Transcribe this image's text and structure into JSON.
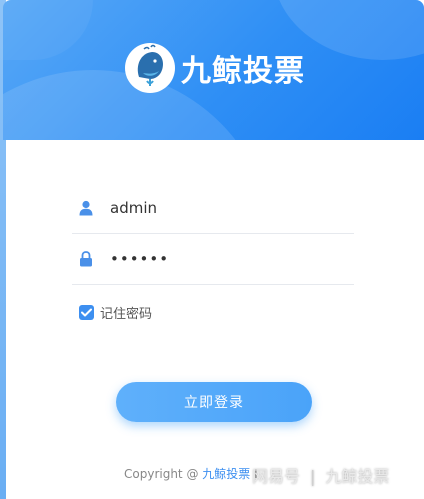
{
  "header": {
    "brand_name": "九鲸投票",
    "logo_icon": "whale-logo-icon",
    "accent_color": "#1a7ef3"
  },
  "form": {
    "username_icon": "user-icon",
    "username_value": "admin",
    "password_icon": "lock-icon",
    "password_value": "••••••",
    "remember_checked": true,
    "remember_label": "记住密码"
  },
  "login_button": {
    "label": "立即登录"
  },
  "footer": {
    "copyright_prefix": "Copyright @",
    "copyright_link": "九鲸投票",
    "copyright_suffix": "I"
  },
  "watermark": {
    "left": "网易号",
    "separator": "|",
    "right": "九鲸投票"
  }
}
